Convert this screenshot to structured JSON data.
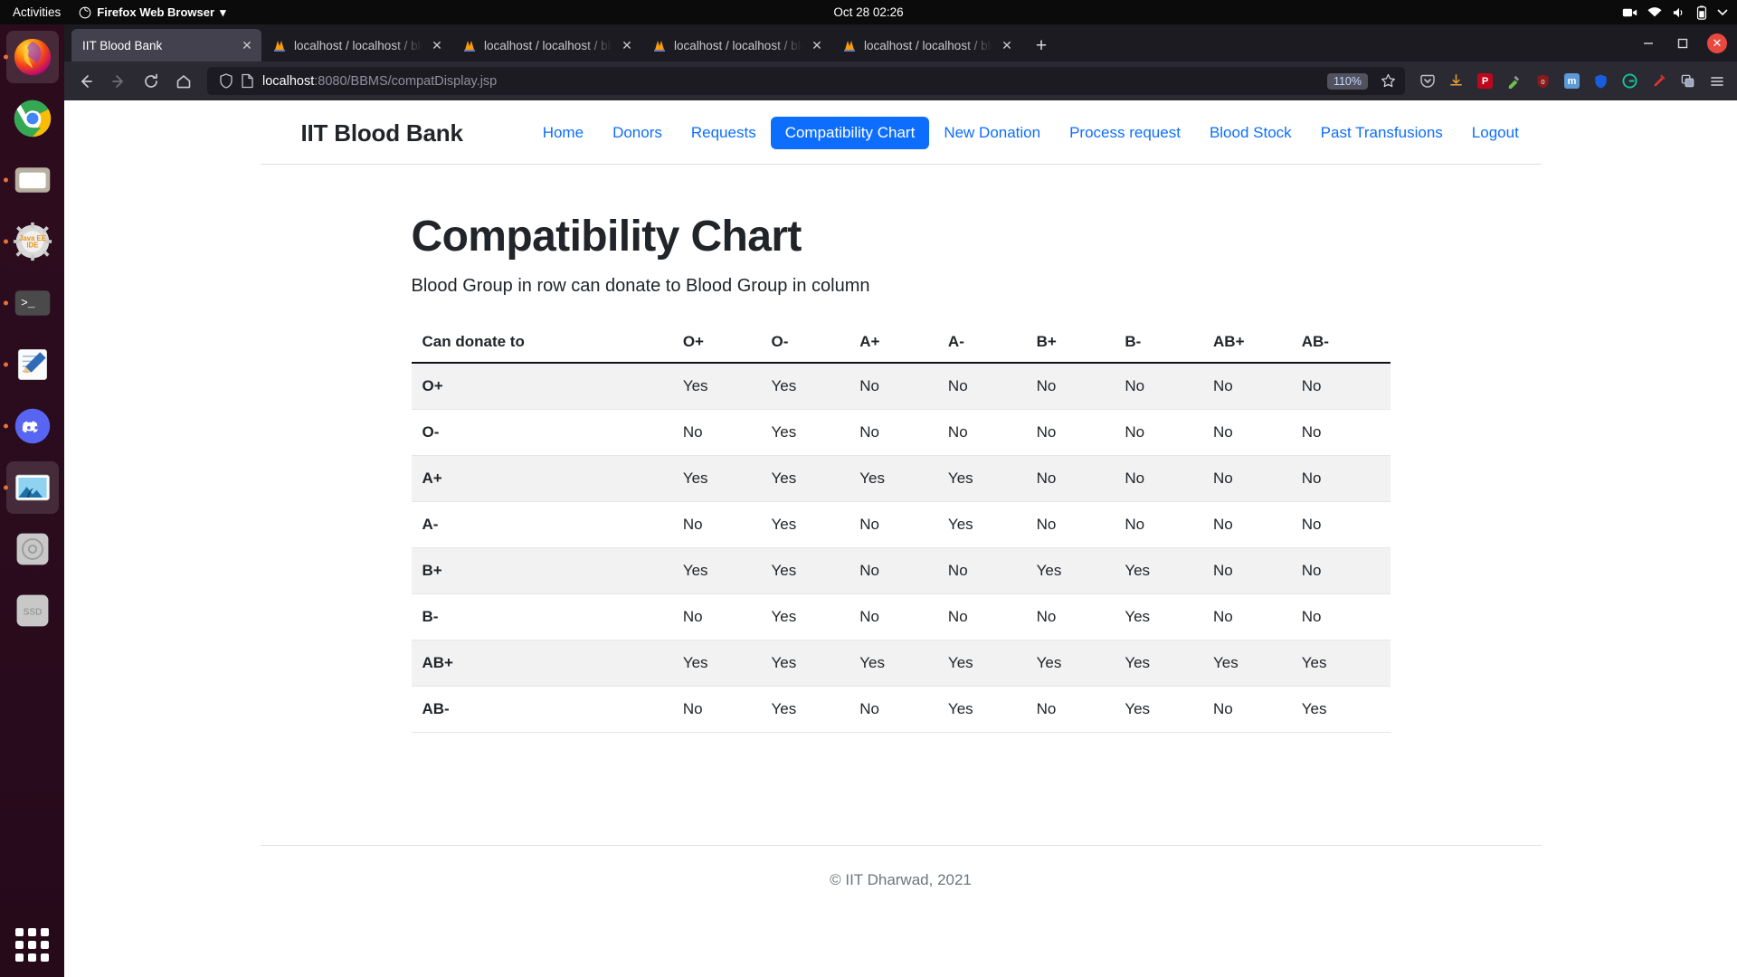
{
  "desktop": {
    "activities_label": "Activities",
    "app_menu_label": "Firefox Web Browser",
    "app_menu_caret": "▾",
    "clock": "Oct 28  02:26",
    "tray_icons": [
      "screencast-icon",
      "network-icon",
      "volume-icon",
      "battery-icon",
      "chevron-down-icon"
    ],
    "dock_items": [
      {
        "name": "firefox",
        "label": "Firefox",
        "running": true,
        "active": true
      },
      {
        "name": "chrome",
        "label": "Google Chrome",
        "running": false,
        "active": false
      },
      {
        "name": "files",
        "label": "Files",
        "running": true,
        "active": false
      },
      {
        "name": "java-ee-ide",
        "label": "Java EE IDE",
        "running": true,
        "active": false,
        "text": "Java EE\nIDE"
      },
      {
        "name": "terminal",
        "label": "Terminal",
        "running": true,
        "active": false,
        "text": ">_"
      },
      {
        "name": "text-editor",
        "label": "Text Editor",
        "running": true,
        "active": false
      },
      {
        "name": "discord",
        "label": "Discord",
        "running": true,
        "active": false
      },
      {
        "name": "image-viewer",
        "label": "Image Viewer",
        "running": true,
        "active": true
      },
      {
        "name": "disc-drive",
        "label": "CD Drive",
        "running": false,
        "active": false
      },
      {
        "name": "ssd-volume",
        "label": "SSD",
        "running": false,
        "active": false,
        "text": "SSD"
      }
    ],
    "show_apps_label": "Show Applications"
  },
  "browser": {
    "tabs": [
      {
        "title": "IIT Blood Bank",
        "active": true,
        "favicon": "none"
      },
      {
        "title": "localhost / localhost / blo",
        "active": false,
        "favicon": "phpmyadmin"
      },
      {
        "title": "localhost / localhost / blo",
        "active": false,
        "favicon": "phpmyadmin"
      },
      {
        "title": "localhost / localhost / blo",
        "active": false,
        "favicon": "phpmyadmin"
      },
      {
        "title": "localhost / localhost / blo",
        "active": false,
        "favicon": "phpmyadmin"
      }
    ],
    "tab_close_glyph": "✕",
    "new_tab_glyph": "+",
    "window_controls": {
      "minimize": "—",
      "maximize": "☐",
      "close": "✕"
    },
    "nav": {
      "back_glyph": "←",
      "forward_glyph": "→",
      "reload_glyph": "↻",
      "home_glyph": "⌂"
    },
    "url": {
      "host": "localhost",
      "path": ":8080/BBMS/compatDisplay.jsp",
      "full": "localhost:8080/BBMS/compatDisplay.jsp"
    },
    "zoom_level": "110%",
    "bookmark_star_glyph": "☆",
    "toolbar_icons": [
      {
        "name": "pocket-icon",
        "glyph": "⌄"
      },
      {
        "name": "downloads-icon",
        "glyph": "↓"
      },
      {
        "name": "pinterest-extension-icon",
        "glyph": "P",
        "color": "#bd081c"
      },
      {
        "name": "colorzilla-extension-icon",
        "glyph": "◐"
      },
      {
        "name": "ublock-origin-icon",
        "glyph": "u0",
        "color": "#800000"
      },
      {
        "name": "momentum-extension-icon",
        "glyph": "m",
        "color": "#5b9ad5"
      },
      {
        "name": "bitwarden-extension-icon",
        "glyph": "▼",
        "color": "#175ddc"
      },
      {
        "name": "grammarly-extension-icon",
        "glyph": "G",
        "color": "#15c39a"
      },
      {
        "name": "honey-extension-icon",
        "glyph": "✎",
        "color": "#e5342c"
      },
      {
        "name": "extensions-icon",
        "glyph": "⧉"
      },
      {
        "name": "app-menu-icon",
        "glyph": "≡"
      }
    ]
  },
  "site": {
    "brand": "IIT Blood Bank",
    "nav_items": [
      {
        "label": "Home",
        "active": false
      },
      {
        "label": "Donors",
        "active": false
      },
      {
        "label": "Requests",
        "active": false
      },
      {
        "label": "Compatibility Chart",
        "active": true
      },
      {
        "label": "New Donation",
        "active": false
      },
      {
        "label": "Process request",
        "active": false
      },
      {
        "label": "Blood Stock",
        "active": false
      },
      {
        "label": "Past Transfusions",
        "active": false
      },
      {
        "label": "Logout",
        "active": false
      }
    ],
    "page_title": "Compatibility Chart",
    "subtitle": "Blood Group in row can donate to Blood Group in column",
    "footer": "© IIT Dharwad, 2021"
  },
  "chart_data": {
    "type": "table",
    "title": "Compatibility Chart",
    "subtitle": "Blood Group in row can donate to Blood Group in column",
    "row_header_label": "Can donate to",
    "categories": [
      "O+",
      "O-",
      "A+",
      "A-",
      "B+",
      "B-",
      "AB+",
      "AB-"
    ],
    "rows": [
      {
        "group": "O+",
        "values": [
          "Yes",
          "Yes",
          "No",
          "No",
          "No",
          "No",
          "No",
          "No"
        ]
      },
      {
        "group": "O-",
        "values": [
          "No",
          "Yes",
          "No",
          "No",
          "No",
          "No",
          "No",
          "No"
        ]
      },
      {
        "group": "A+",
        "values": [
          "Yes",
          "Yes",
          "Yes",
          "Yes",
          "No",
          "No",
          "No",
          "No"
        ]
      },
      {
        "group": "A-",
        "values": [
          "No",
          "Yes",
          "No",
          "Yes",
          "No",
          "No",
          "No",
          "No"
        ]
      },
      {
        "group": "B+",
        "values": [
          "Yes",
          "Yes",
          "No",
          "No",
          "Yes",
          "Yes",
          "No",
          "No"
        ]
      },
      {
        "group": "B-",
        "values": [
          "No",
          "Yes",
          "No",
          "No",
          "No",
          "Yes",
          "No",
          "No"
        ]
      },
      {
        "group": "AB+",
        "values": [
          "Yes",
          "Yes",
          "Yes",
          "Yes",
          "Yes",
          "Yes",
          "Yes",
          "Yes"
        ]
      },
      {
        "group": "AB-",
        "values": [
          "No",
          "Yes",
          "No",
          "Yes",
          "No",
          "Yes",
          "No",
          "Yes"
        ]
      }
    ]
  },
  "colors": {
    "accent": "#0d6efd",
    "page_text": "#212529",
    "muted": "#6c757d",
    "stripe": "#f2f2f3",
    "chrome_dark": "#2b2a33",
    "tabstrip": "#1c1b22"
  }
}
